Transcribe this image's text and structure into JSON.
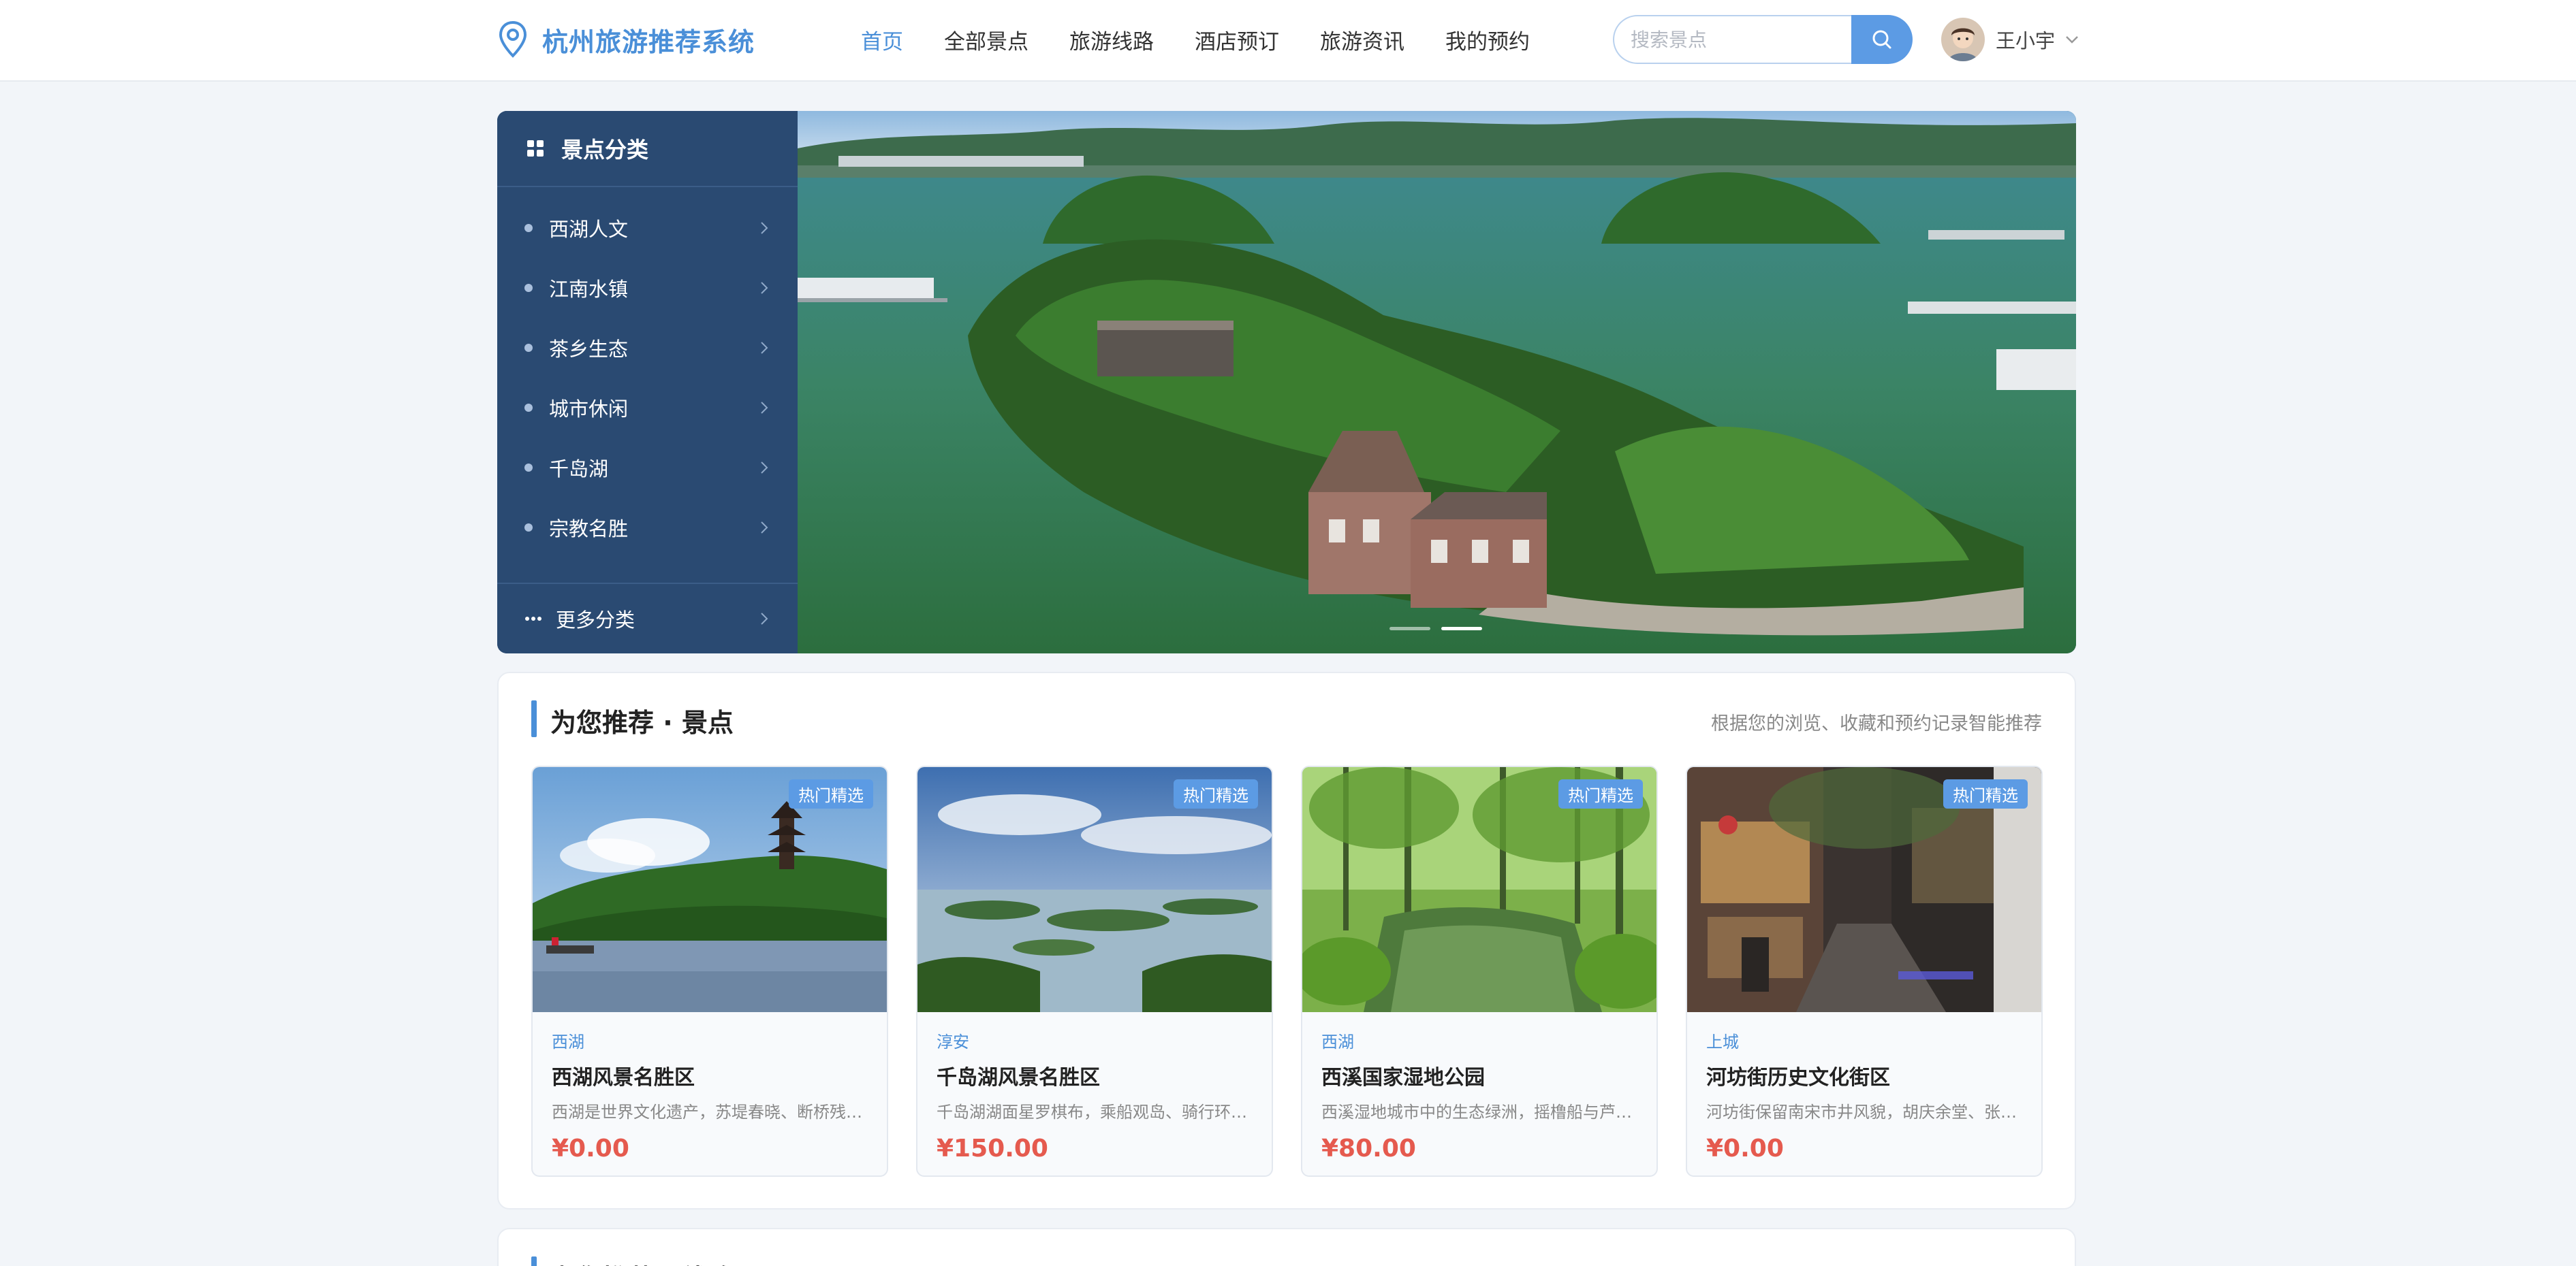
{
  "header": {
    "logo_text": "杭州旅游推荐系统",
    "nav": [
      "首页",
      "全部景点",
      "旅游线路",
      "酒店预订",
      "旅游资讯",
      "我的预约"
    ],
    "active_nav": "首页",
    "search_placeholder": "搜索景点",
    "user_name": "王小宇"
  },
  "categories": {
    "title": "景点分类",
    "items": [
      "西湖人文",
      "江南水镇",
      "茶乡生态",
      "城市休闲",
      "千岛湖",
      "宗教名胜"
    ],
    "more_label": "更多分类"
  },
  "carousel": {
    "slide_count": 2,
    "active_slide": 2
  },
  "recommend": {
    "title": "为您推荐 · 景点",
    "hint": "根据您的浏览、收藏和预约记录智能推荐",
    "cards": [
      {
        "tag": "热门精选",
        "area": "西湖",
        "name": "西湖风景名胜区",
        "desc": "西湖是世界文化遗产，苏堤春晓、断桥残…",
        "price": "¥0.00"
      },
      {
        "tag": "热门精选",
        "area": "淳安",
        "name": "千岛湖风景名胜区",
        "desc": "千岛湖湖面星罗棋布，乘船观岛、骑行环…",
        "price": "¥150.00"
      },
      {
        "tag": "热门精选",
        "area": "西湖",
        "name": "西溪国家湿地公园",
        "desc": "西溪湿地城市中的生态绿洲，摇橹船与芦…",
        "price": "¥80.00"
      },
      {
        "tag": "热门精选",
        "area": "上城",
        "name": "河坊街历史文化街区",
        "desc": "河坊街保留南宋市井风貌，胡庆余堂、张…",
        "price": "¥0.00"
      }
    ]
  },
  "recommend_routes": {
    "title": "为您推荐 · 线路"
  },
  "colors": {
    "brand": "#4a8fd8",
    "sidebar": "#2a4a72",
    "price": "#e55a4e",
    "tag": "#5c9be4"
  }
}
